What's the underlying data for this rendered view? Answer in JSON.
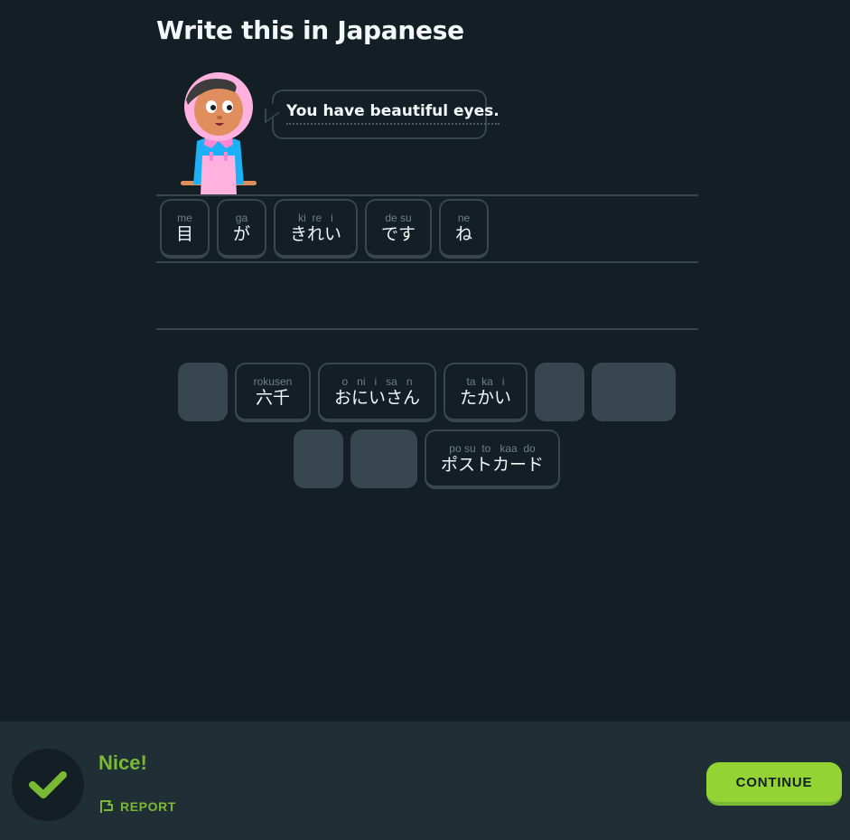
{
  "prompt": {
    "title": "Write this in Japanese"
  },
  "speech_bubble": {
    "text": "You have beautiful eyes."
  },
  "answer_tiles": [
    {
      "romaji": "me",
      "kana": "目"
    },
    {
      "romaji": "ga",
      "kana": "が"
    },
    {
      "romaji": "ki  re   i",
      "kana": "きれい"
    },
    {
      "romaji": "de su",
      "kana": "です"
    },
    {
      "romaji": "ne",
      "kana": "ね"
    }
  ],
  "word_bank": {
    "row1": [
      {
        "romaji": "rokusen",
        "kana": "六千"
      },
      {
        "romaji": "o   ni   i   sa   n",
        "kana": "おにいさん"
      },
      {
        "romaji": "ta  ka   i",
        "kana": "たかい"
      }
    ],
    "row2": [
      {
        "romaji": "po su  to   kaa  do",
        "kana": "ポストカード"
      }
    ]
  },
  "footer": {
    "feedback": "Nice!",
    "report_label": "REPORT",
    "continue_label": "CONTINUE"
  },
  "colors": {
    "background": "#131f24",
    "footer_background": "#202f36",
    "border": "#37464f",
    "success_green": "#79b933",
    "button_green": "#93d333"
  }
}
